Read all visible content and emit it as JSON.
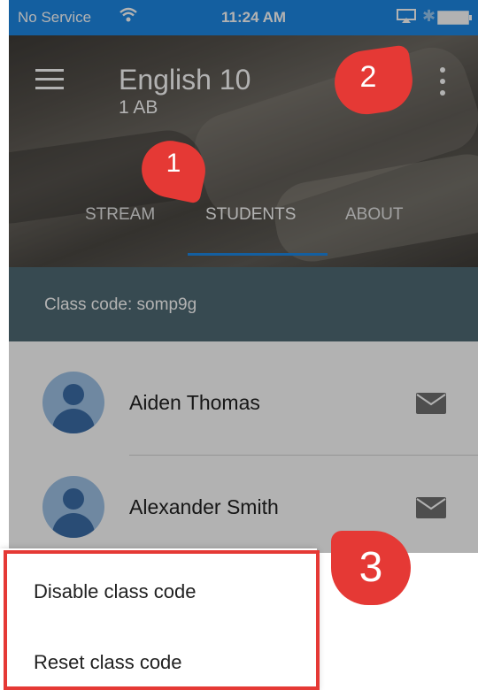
{
  "status_bar": {
    "carrier": "No Service",
    "time": "11:24 AM"
  },
  "header": {
    "title": "English 10",
    "subtitle": "1 AB",
    "tabs": [
      {
        "label": "STREAM",
        "active": false
      },
      {
        "label": "STUDENTS",
        "active": true
      },
      {
        "label": "ABOUT",
        "active": false
      }
    ]
  },
  "class_code": {
    "text": "Class code: somp9g"
  },
  "students": [
    {
      "name": "Aiden Thomas"
    },
    {
      "name": "Alexander Smith"
    }
  ],
  "popup_menu": {
    "items": [
      {
        "label": "Disable class code"
      },
      {
        "label": "Reset class code"
      }
    ]
  },
  "callouts": {
    "one": "1",
    "two": "2",
    "three": "3"
  },
  "colors": {
    "accent": "#1e88e5",
    "callout": "#e53935",
    "code_bar": "#4f6a74"
  }
}
